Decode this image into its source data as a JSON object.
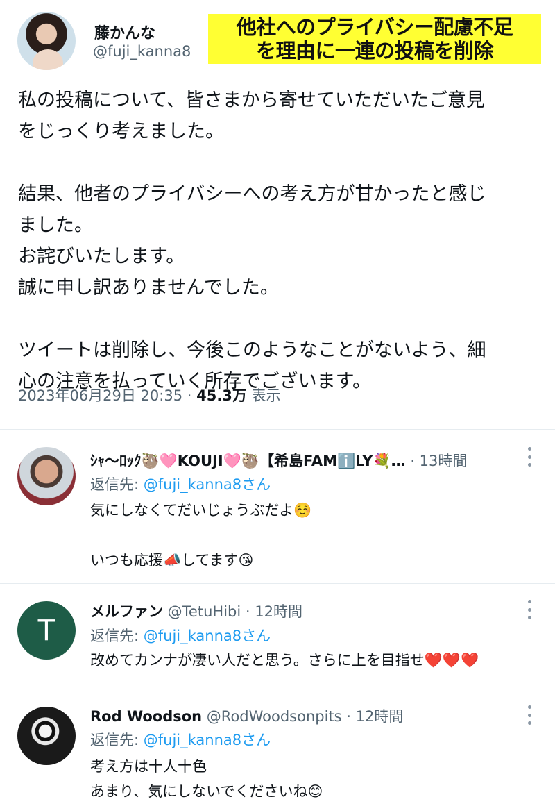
{
  "main_tweet": {
    "display_name": "藤かんな",
    "handle": "@fuji_kanna8",
    "overlay_caption_line1": "他社へのプライバシー配慮不足",
    "overlay_caption_line2": "を理由に一連の投稿を削除",
    "body_lines": [
      "私の投稿について、皆さまから寄せていただいたご意見",
      "をじっくり考えました。",
      "",
      "結果、他者のプライバシーへの考え方が甘かったと感じ",
      "ました。",
      "お詫びいたします。",
      "誠に申し訳ありませんでした。",
      "",
      "ツイートは削除し、今後このようなことがないよう、細",
      "心の注意を払っていく所存でございます。"
    ],
    "timestamp": "2023年06月29日 20:35 · ",
    "views_count": "45.3万",
    "views_label": " 表示"
  },
  "replies": [
    {
      "display_name": "ｼｬ〜ﾛｯｸ🦥🩷KOUJI🩷🦥【希島FAMℹ️LY💐…",
      "handle": "",
      "time": " · 13時間",
      "reply_to_prefix": "返信先: ",
      "reply_to_mention": "@fuji_kanna8さん",
      "text": "気にしなくてだいじょうぶだよ☺️\n\nいつも応援📣してます😘",
      "avatar_icon": "person-photo-avatar"
    },
    {
      "display_name": "メルファン",
      "handle": " @TetuHibi",
      "time": " · 12時間",
      "reply_to_prefix": "返信先: ",
      "reply_to_mention": "@fuji_kanna8さん",
      "text": "改めてカンナが凄い人だと思う。さらに上を目指せ❤️❤️❤️",
      "avatar_letter": "T",
      "avatar_color": "#1e5c47"
    },
    {
      "display_name": "Rod Woodson",
      "handle": " @RodWoodsonpits",
      "time": " · 12時間",
      "reply_to_prefix": "返信先: ",
      "reply_to_mention": "@fuji_kanna8さん",
      "text": "考え方は十人十色\nあまり、気にしないでくださいね😊",
      "avatar_icon": "skull-pirate-avatar"
    }
  ],
  "colors": {
    "link": "#1d9bf0",
    "secondary_text": "#536471",
    "caption_highlight": "#ffff33"
  }
}
